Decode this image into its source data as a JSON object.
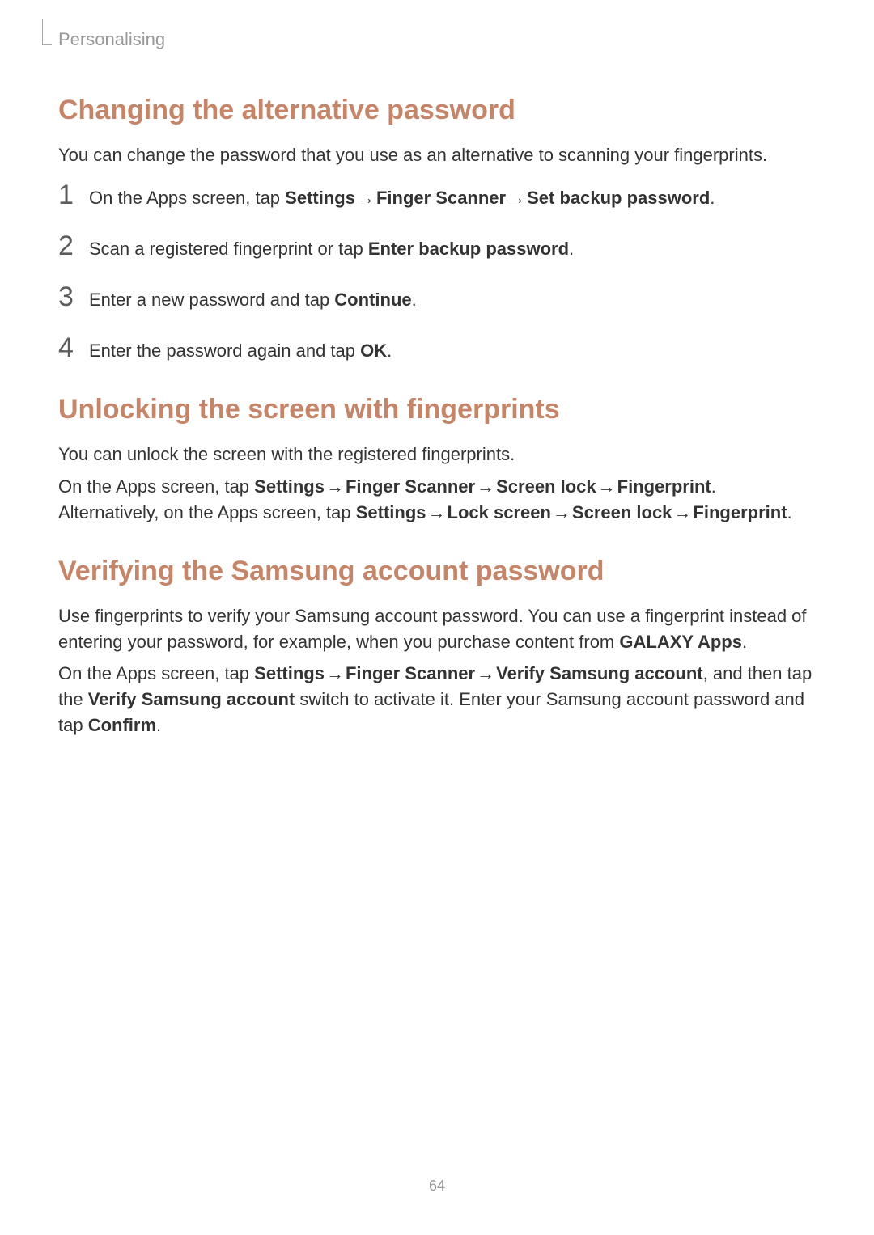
{
  "header": {
    "chapter": "Personalising"
  },
  "arrow": "→",
  "sections": [
    {
      "title": "Changing the alternative password",
      "intro": "You can change the password that you use as an alternative to scanning your fingerprints.",
      "steps": [
        {
          "num": "1",
          "pre": "On the Apps screen, tap ",
          "path": [
            "Settings",
            "Finger Scanner",
            "Set backup password"
          ],
          "post": "."
        },
        {
          "num": "2",
          "pre": "Scan a registered fingerprint or tap ",
          "bold": "Enter backup password",
          "post": "."
        },
        {
          "num": "3",
          "pre": "Enter a new password and tap ",
          "bold": "Continue",
          "post": "."
        },
        {
          "num": "4",
          "pre": "Enter the password again and tap ",
          "bold": "OK",
          "post": "."
        }
      ]
    },
    {
      "title": "Unlocking the screen with fingerprints",
      "intro": "You can unlock the screen with the registered fingerprints.",
      "line2_pre": "On the Apps screen, tap ",
      "line2_path": [
        "Settings",
        "Finger Scanner",
        "Screen lock",
        "Fingerprint"
      ],
      "line2_post": ". Alternatively, on the Apps screen, tap ",
      "line2b_path": [
        "Settings",
        "Lock screen",
        "Screen lock",
        "Fingerprint"
      ],
      "line2b_post": "."
    },
    {
      "title": "Verifying the Samsung account password",
      "p1_pre": "Use fingerprints to verify your Samsung account password. You can use a fingerprint instead of entering your password, for example, when you purchase content from ",
      "p1_bold": "GALAXY Apps",
      "p1_post": ".",
      "p2_pre": "On the Apps screen, tap ",
      "p2_path": [
        "Settings",
        "Finger Scanner",
        "Verify Samsung account"
      ],
      "p2_mid": ", and then tap the ",
      "p2_bold": "Verify Samsung account",
      "p2_mid2": " switch to activate it. Enter your Samsung account password and tap ",
      "p2_bold2": "Confirm",
      "p2_post": "."
    }
  ],
  "pageNumber": "64"
}
